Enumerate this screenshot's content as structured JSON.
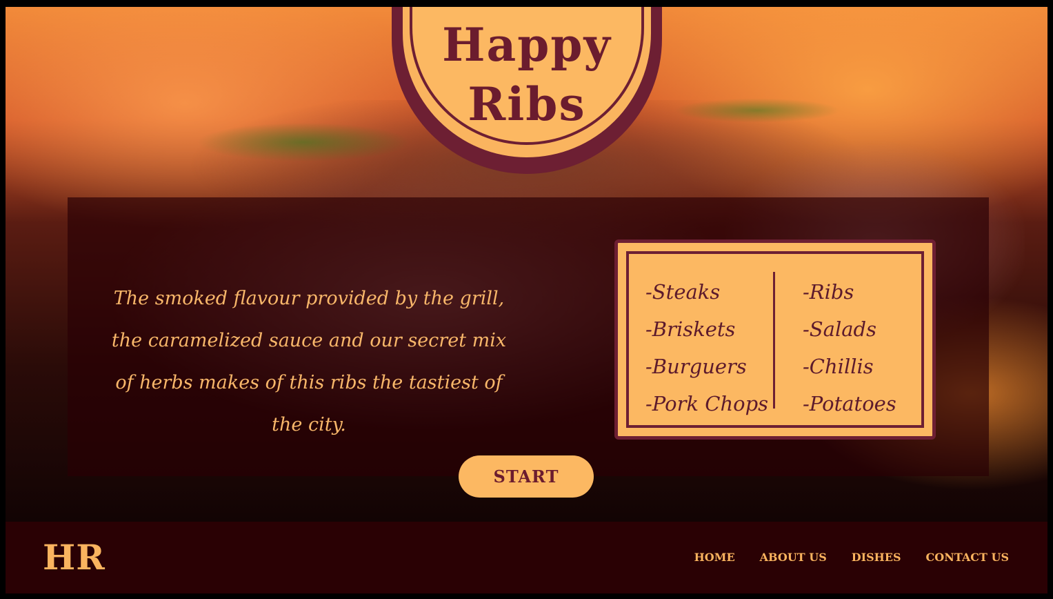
{
  "brand": {
    "title_line1": "Happy",
    "title_line2": "Ribs",
    "short": "HR"
  },
  "hero": {
    "tagline": "The smoked flavour provided by the grill, the caramelized sauce and our secret mix of herbs makes of this ribs the tastiest of the city.",
    "start_label": "START"
  },
  "menu": {
    "left": [
      "-Steaks",
      "-Briskets",
      "-Burguers",
      "-Pork Chops"
    ],
    "right": [
      "-Ribs",
      "-Salads",
      "-Chillis",
      "-Potatoes"
    ]
  },
  "nav": {
    "items": [
      "HOME",
      "ABOUT US",
      "DISHES",
      "CONTACT US"
    ]
  },
  "colors": {
    "accent": "#fcb862",
    "brand_dark": "#6d1f33",
    "footer_bg": "#2a0104"
  }
}
